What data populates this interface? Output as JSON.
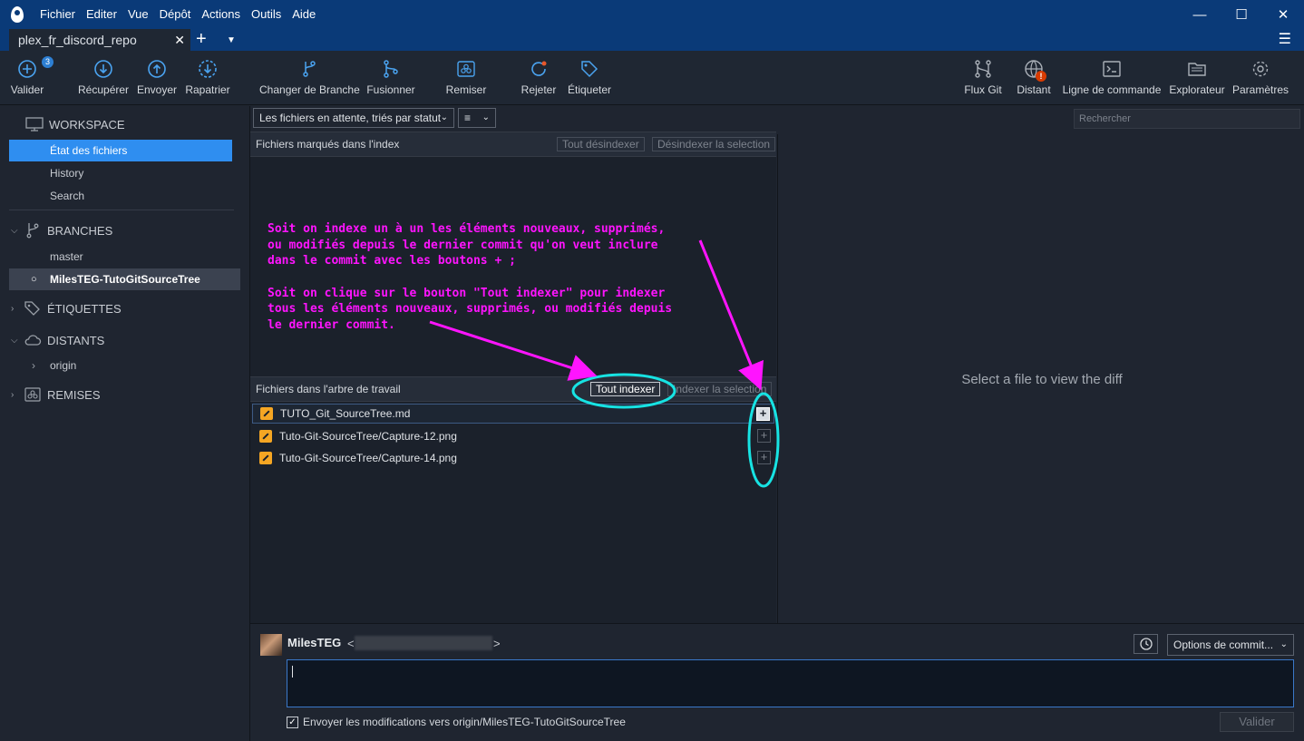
{
  "menu": [
    "Fichier",
    "Editer",
    "Vue",
    "Dépôt",
    "Actions",
    "Outils",
    "Aide"
  ],
  "tab": {
    "title": "plex_fr_discord_repo"
  },
  "toolbar": {
    "valider": "Valider",
    "valider_badge": "3",
    "recuperer": "Récupérer",
    "envoyer": "Envoyer",
    "rapatrier": "Rapatrier",
    "changer_branche": "Changer de Branche",
    "fusionner": "Fusionner",
    "remiser": "Remiser",
    "rejeter": "Rejeter",
    "etiqueter": "Étiqueter",
    "flux_git": "Flux Git",
    "distant": "Distant",
    "distant_badge": "!",
    "ligne_commande": "Ligne de commande",
    "explorateur": "Explorateur",
    "parametres": "Paramètres"
  },
  "sidebar": {
    "workspace": "WORKSPACE",
    "workspace_items": [
      "État des fichiers",
      "History",
      "Search"
    ],
    "branches": "BRANCHES",
    "branch_items": [
      "master",
      "MilesTEG-TutoGitSourceTree"
    ],
    "etiquettes": "ÉTIQUETTES",
    "distants": "DISTANTS",
    "remote_items": [
      "origin"
    ],
    "remises": "REMISES"
  },
  "filter": {
    "sort": "Les fichiers en attente, triés par statut",
    "view": "≡",
    "search_placeholder": "Rechercher"
  },
  "staged": {
    "title": "Fichiers marqués dans l'index",
    "unstage_all": "Tout désindexer",
    "unstage_selection": "Désindexer la selection"
  },
  "unstaged": {
    "title": "Fichiers dans l'arbre de travail",
    "stage_all": "Tout indexer",
    "stage_selection": "Indexer la selection",
    "files": [
      "TUTO_Git_SourceTree.md",
      "Tuto-Git-SourceTree/Capture-12.png",
      "Tuto-Git-SourceTree/Capture-14.png"
    ]
  },
  "diff": {
    "placeholder": "Select a file to view the diff"
  },
  "annotation": {
    "line1": "Soit on indexe un à un les éléments nouveaux, supprimés,",
    "line2": "ou modifiés depuis le dernier commit qu'on veut inclure",
    "line3": "dans le commit avec les boutons + ;",
    "line4": "Soit on clique sur le bouton \"Tout indexer\" pour indexer",
    "line5": "tous les éléments nouveaux, supprimés, ou modifiés depuis",
    "line6": "le dernier commit."
  },
  "commit": {
    "author": "MilesTEG",
    "email_open": "<",
    "email_close": ">",
    "options": "Options de commit...",
    "push_label": "Envoyer les modifications vers origin/MilesTEG-TutoGitSourceTree",
    "submit": "Valider"
  },
  "colors": {
    "titlebar": "#0a3a78",
    "accent": "#2f8ef0",
    "annotation": "#ff14ff",
    "highlight": "#17e3e3",
    "modified": "#f5a623"
  }
}
